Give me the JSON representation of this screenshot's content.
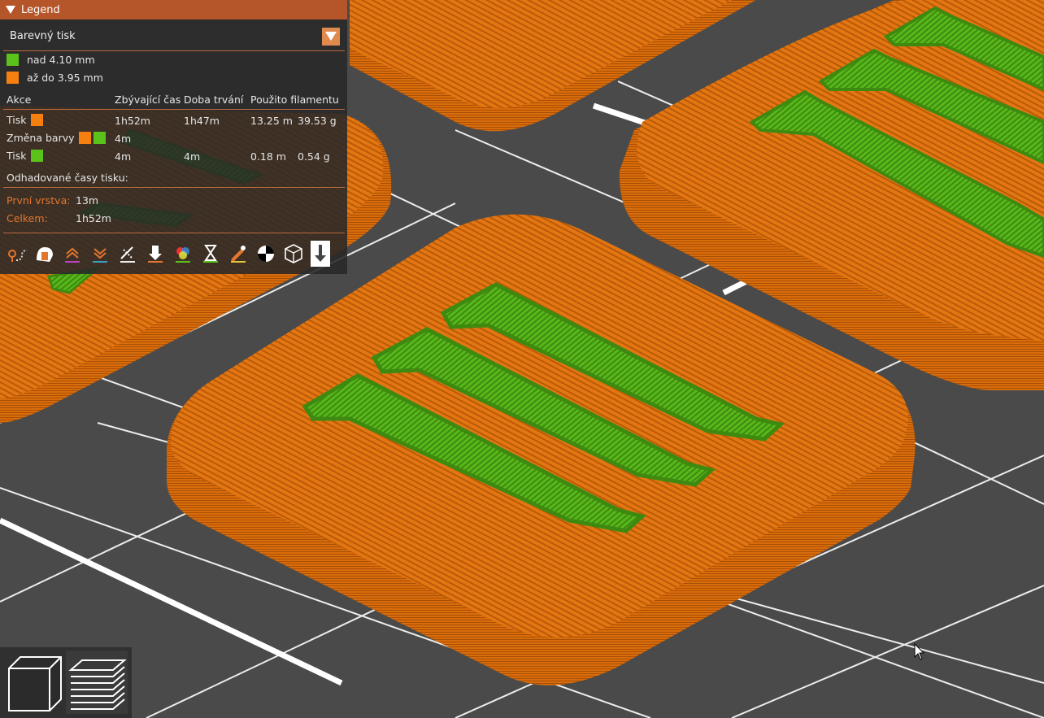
{
  "legend": {
    "title": "Legend",
    "view_type": {
      "selected": "Barevný tisk"
    },
    "color_ranges": [
      {
        "label": "nad 4.10 mm",
        "color": "#5bc21c"
      },
      {
        "label": "až do 3.95 mm",
        "color": "#f5800f"
      }
    ],
    "table": {
      "headers": [
        "Akce",
        "Zbývající čas",
        "Doba trvání",
        "Použito filamentu"
      ],
      "rows": [
        {
          "action": "Tisk",
          "remaining": "1h52m",
          "duration": "1h47m",
          "length": "13.25 m",
          "weight": "39.53 g"
        },
        {
          "action": "Změna barvy",
          "remaining": "4m",
          "duration": "",
          "length": "",
          "weight": ""
        },
        {
          "action": "Tisk",
          "remaining": "4m",
          "duration": "4m",
          "length": "0.18 m",
          "weight": "0.54 g"
        }
      ]
    },
    "estimated_title": "Odhadované časy tisku:",
    "first_layer": {
      "label": "První vrstva:",
      "value": "13m"
    },
    "total": {
      "label": "Celkem:",
      "value": "1h52m"
    },
    "toolbar": [
      {
        "name": "travel-icon"
      },
      {
        "name": "wipe-icon"
      },
      {
        "name": "retractions-icon"
      },
      {
        "name": "deretractions-icon"
      },
      {
        "name": "seams-icon"
      },
      {
        "name": "tool-changes-icon"
      },
      {
        "name": "color-changes-icon"
      },
      {
        "name": "pause-print-icon"
      },
      {
        "name": "custom-gcode-icon"
      },
      {
        "name": "center-of-gravity-icon"
      },
      {
        "name": "shells-icon"
      },
      {
        "name": "tool-marker-icon"
      }
    ]
  },
  "view_buttons": [
    {
      "name": "3d-view-icon"
    },
    {
      "name": "layers-view-icon"
    }
  ],
  "colors": {
    "orange": "#f5800f",
    "green": "#5bc21c",
    "bed": "#4a4a4a",
    "legend_header": "#b5552a",
    "accent": "#e3762f"
  }
}
